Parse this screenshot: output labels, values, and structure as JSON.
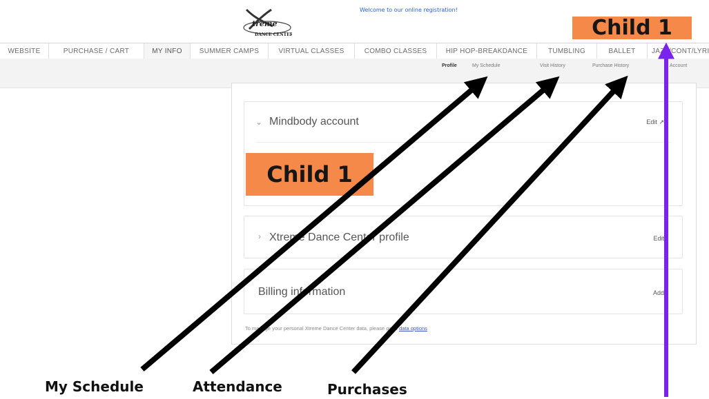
{
  "header": {
    "logo_alt": "Xtreme Dance Center",
    "welcome": "Welcome to our online registration!"
  },
  "badges": {
    "top": "Child 1",
    "card": "Child 1"
  },
  "nav": {
    "tabs": [
      {
        "label": "WEBSITE"
      },
      {
        "label": "PURCHASE / CART"
      },
      {
        "label": "MY INFO",
        "active": true
      },
      {
        "label": "SUMMER CAMPS"
      },
      {
        "label": "VIRTUAL CLASSES"
      },
      {
        "label": "COMBO CLASSES"
      },
      {
        "label": "HIP HOP-BREAKDANCE"
      },
      {
        "label": "TUMBLING"
      },
      {
        "label": "BALLET"
      },
      {
        "label": "JAZZ/CONT/LYRICAL"
      }
    ]
  },
  "subnav": {
    "links": [
      {
        "label": "Profile",
        "active": true
      },
      {
        "label": "My Schedule"
      },
      {
        "label": "Visit History"
      },
      {
        "label": "Purchase History"
      },
      {
        "label": "Account"
      }
    ]
  },
  "cards": {
    "mindbody": {
      "title": "Mindbody account",
      "action": "Edit",
      "chevron": "chevron-down-icon"
    },
    "profile": {
      "title": "Xtreme Dance Center profile",
      "action": "Edit",
      "chevron": "chevron-right-icon"
    },
    "billing": {
      "title": "Billing information",
      "action": "Add"
    }
  },
  "footnote": {
    "text": "To manage your personal Xtreme Dance Center data, please go to ",
    "link": "data options"
  },
  "annotations": {
    "captions": [
      "My Schedule",
      "Attendance",
      "Purchases"
    ],
    "arrow_color": "#000000",
    "vertical_arrow_color": "#7a22ee",
    "badge_color": "#f5894a"
  }
}
